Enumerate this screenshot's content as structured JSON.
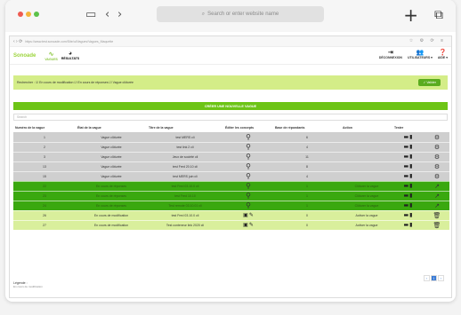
{
  "browser": {
    "address_placeholder": "Search or enter website name",
    "inner_url": "https://www.test.sonoade.com/Site/ui/Vagues/Vagues_Maquette",
    "back_glyph": "‹",
    "forward_glyph": "›",
    "sidebar_glyph": "▭",
    "plus_glyph": "+",
    "tabs_glyph": "⧉"
  },
  "app": {
    "brand": "Sonoade",
    "nav": [
      {
        "label": "VAGUES",
        "icon": "wave-icon",
        "glyph": "∿"
      },
      {
        "label": "RÉSULTATS",
        "icon": "pie-chart-icon",
        "glyph": "◕"
      }
    ],
    "right_nav": [
      {
        "label": "DÉCONNEXION",
        "icon": "logout-icon",
        "glyph": "⇥"
      },
      {
        "label": "UTILISATEURS ▾",
        "icon": "users-icon",
        "glyph": "👥"
      },
      {
        "label": "AIDE ▾",
        "icon": "help-icon",
        "glyph": "❓"
      }
    ]
  },
  "filter": {
    "text": "Rechercher : ☑ En cours de modification ☑ En cours de réponses ☑ Vague clôturée",
    "button": "✓ Valider"
  },
  "create_button": "CRÉER UNE NOUVELLE VAGUE",
  "search_placeholder": "Search",
  "table": {
    "headers": [
      "Numéro de la vague",
      "État de la vague",
      "Titre de la vague",
      "Éditer les concepts",
      "Base de répondants",
      "Action",
      "Tester",
      ""
    ],
    "rows": [
      {
        "num": "1",
        "state": "Vague clôturée",
        "title": "test MERS cli",
        "base": "6",
        "action": "",
        "status": "gray"
      },
      {
        "num": "2",
        "state": "Vague clôturée",
        "title": "test link 2 cli",
        "base": "4",
        "action": "",
        "status": "gray"
      },
      {
        "num": "3",
        "state": "Vague clôturée",
        "title": "Jeux de société cli",
        "base": "11",
        "action": "",
        "status": "gray"
      },
      {
        "num": "13",
        "state": "Vague clôturée",
        "title": "test Fred 20.10 cli",
        "base": "8",
        "action": "",
        "status": "gray"
      },
      {
        "num": "15",
        "state": "Vague clôturée",
        "title": "test MERS juin cli",
        "base": "4",
        "action": "",
        "status": "gray"
      },
      {
        "num": "22",
        "state": "En cours de réponses",
        "title": "test Fred 03.10.0 cli",
        "base": "1",
        "action": "Clôturer la vague",
        "status": "green"
      },
      {
        "num": "23",
        "state": "En cours de réponses",
        "title": "test Fred 10.10",
        "base": "1",
        "action": "Clôturer la vague",
        "status": "green"
      },
      {
        "num": "24",
        "state": "En cours de réponses",
        "title": "Test remote 03.10.01 cli",
        "base": "1",
        "action": "Clôturer la vague",
        "status": "green"
      },
      {
        "num": "26",
        "state": "En cours de modification",
        "title": "test Fred 03.10.0 cli",
        "base": "0",
        "action": "Activer la vague",
        "status": "lime"
      },
      {
        "num": "27",
        "state": "En cours de modification",
        "title": "Test conteneur link 2020 cli",
        "base": "0",
        "action": "Activer la vague",
        "status": "lime"
      }
    ]
  },
  "pager": [
    "‹",
    "1",
    "›"
  ],
  "legend": {
    "title": "Légende :",
    "item": "En cours de modification"
  },
  "colors": {
    "gray_row": "#cfcfcf",
    "green_row": "#3aa80f",
    "lime_row": "#d9ef9c",
    "accent": "#6dc416"
  }
}
